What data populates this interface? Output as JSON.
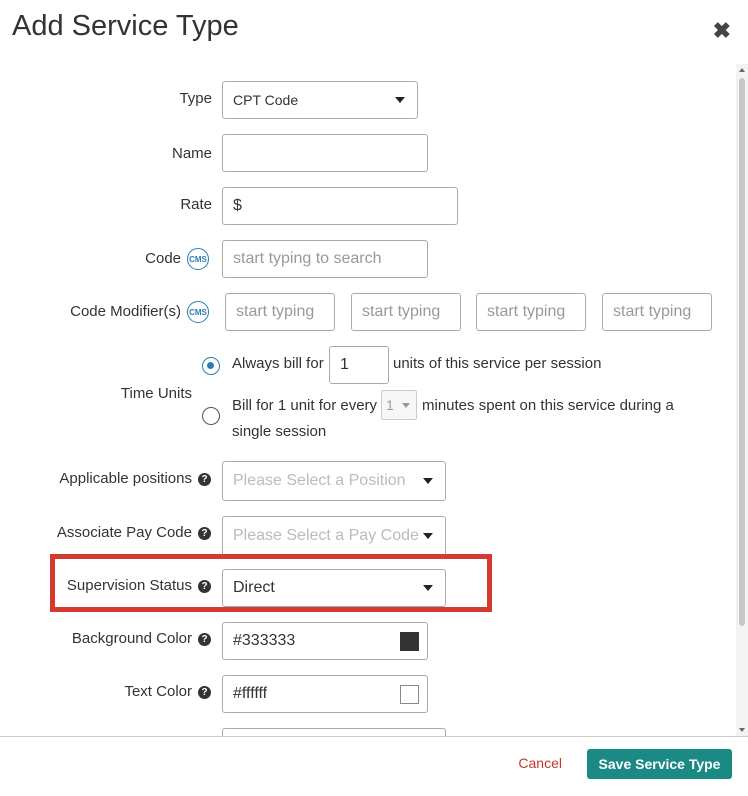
{
  "dialog": {
    "title": "Add Service Type",
    "close_icon": "close-icon"
  },
  "form": {
    "type": {
      "label": "Type",
      "value": "CPT Code"
    },
    "name": {
      "label": "Name",
      "value": ""
    },
    "rate": {
      "label": "Rate",
      "prefix": "$",
      "value": ""
    },
    "code": {
      "label": "Code",
      "badge": "CMS",
      "placeholder": "start typing to search"
    },
    "code_modifiers": {
      "label": "Code Modifier(s)",
      "badge": "CMS",
      "placeholders": [
        "start typing",
        "start typing",
        "start typing",
        "start typing"
      ]
    },
    "time_units": {
      "label": "Time Units",
      "option1_prefix": "Always bill for",
      "option1_value": "1",
      "option1_suffix": "units of this service per session",
      "option2_prefix": "Bill for 1 unit for every",
      "option2_value": "1",
      "option2_suffix": "minutes spent on this service during a",
      "option2_suffix2": "single session",
      "selected": 1
    },
    "applicable_positions": {
      "label": "Applicable positions",
      "placeholder": "Please Select a Position"
    },
    "associate_pay_code": {
      "label": "Associate Pay Code",
      "placeholder": "Please Select a Pay Code"
    },
    "supervision_status": {
      "label": "Supervision Status",
      "value": "Direct"
    },
    "background_color": {
      "label": "Background Color",
      "value": "#333333",
      "swatch": "#333333"
    },
    "text_color": {
      "label": "Text Color",
      "value": "#ffffff",
      "swatch": "#ffffff"
    }
  },
  "footer": {
    "cancel_label": "Cancel",
    "save_label": "Save Service Type"
  },
  "colors": {
    "accent": "#1c8a84",
    "cancel": "#c0392b",
    "highlight": "#d63a2f",
    "link_blue": "#2a7db5"
  }
}
